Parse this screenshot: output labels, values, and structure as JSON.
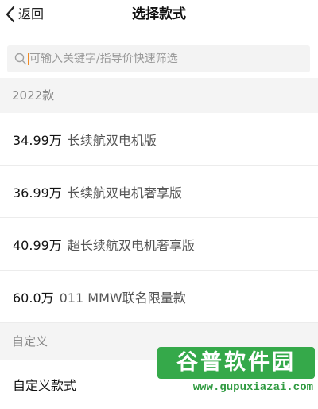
{
  "header": {
    "back_label": "返回",
    "title": "选择款式"
  },
  "search": {
    "placeholder": "可输入关键字/指导价快速筛选",
    "value": ""
  },
  "sections": [
    {
      "title": "2022款",
      "items": [
        {
          "price": "34.99万",
          "name": "长续航双电机版"
        },
        {
          "price": "36.99万",
          "name": "长续航双电机奢享版"
        },
        {
          "price": "40.99万",
          "name": "超长续航双电机奢享版"
        },
        {
          "price": "60.0万",
          "name": "011 MMW联名限量款"
        }
      ]
    },
    {
      "title": "自定义",
      "items": [
        {
          "label": "自定义款式"
        }
      ]
    }
  ],
  "watermark": {
    "logo_text": "谷普软件园",
    "url": "www.gupuxiazai.com"
  },
  "colors": {
    "accent_caret": "#f08a24",
    "section_bg": "#f4f4f4",
    "watermark_green": "#35a94a"
  }
}
